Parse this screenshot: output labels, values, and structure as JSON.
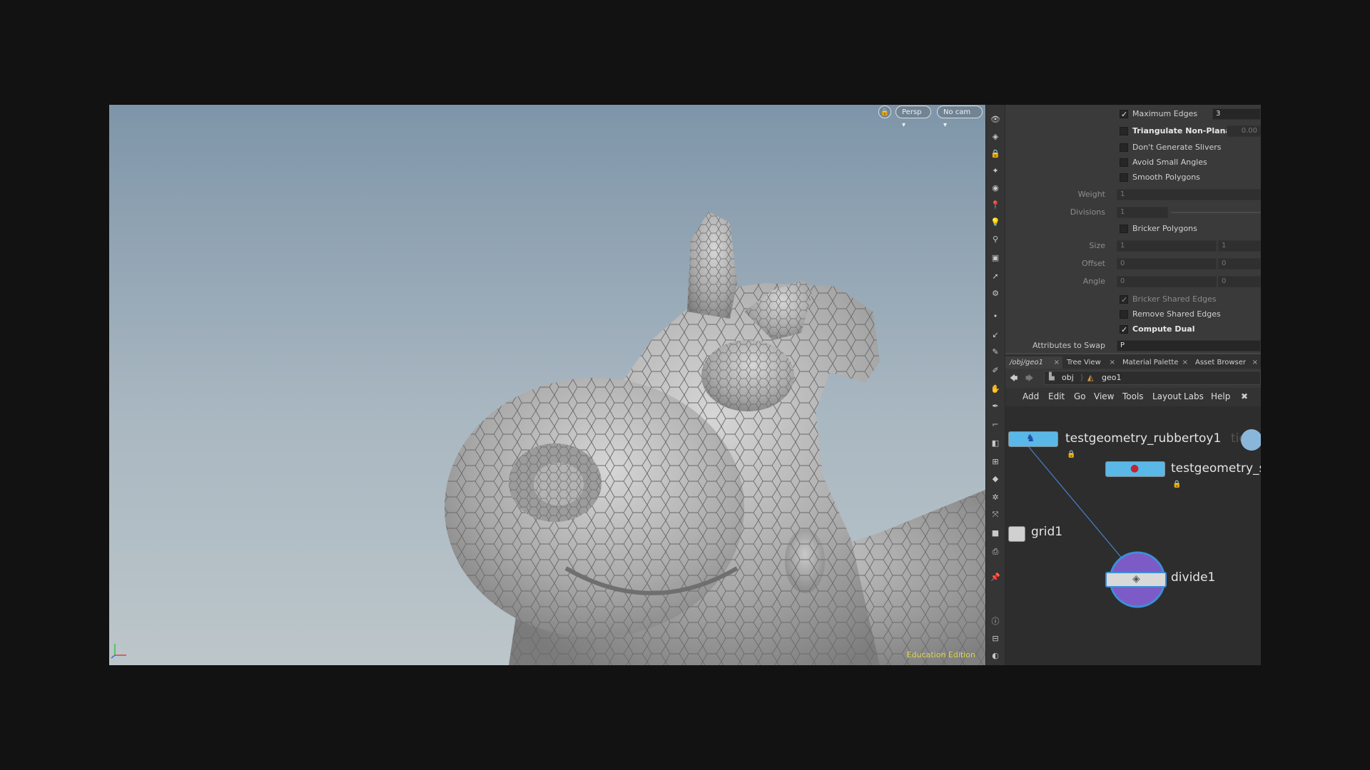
{
  "viewport": {
    "view_menu": "Persp ▾",
    "camera_menu": "No cam ▾",
    "edition": "Education Edition",
    "colors": {
      "sky_top": "#7e95a9",
      "sky_bottom": "#bcc6ca",
      "edition_text": "#e2d84a"
    }
  },
  "params": {
    "maximum_edges": {
      "label": "Maximum Edges",
      "checked": true,
      "value": "3"
    },
    "triangulate_non_planar": {
      "label": "Triangulate Non-Planar",
      "checked": false,
      "value": "0.00"
    },
    "dont_generate_slivers": {
      "label": "Don't Generate Slivers",
      "checked": false
    },
    "avoid_small_angles": {
      "label": "Avoid Small Angles",
      "checked": false
    },
    "smooth_polygons": {
      "label": "Smooth Polygons",
      "checked": false
    },
    "weight": {
      "label": "Weight",
      "value": "1"
    },
    "divisions": {
      "label": "Divisions",
      "value": "1"
    },
    "bricker_polygons": {
      "label": "Bricker Polygons",
      "checked": false
    },
    "size": {
      "label": "Size",
      "values": [
        "1",
        "1"
      ]
    },
    "offset": {
      "label": "Offset",
      "values": [
        "0",
        "0"
      ]
    },
    "angle": {
      "label": "Angle",
      "values": [
        "0",
        "0"
      ]
    },
    "bricker_shared_edges": {
      "label": "Bricker Shared Edges",
      "checked": true
    },
    "remove_shared_edges": {
      "label": "Remove Shared Edges",
      "checked": false
    },
    "compute_dual": {
      "label": "Compute Dual",
      "checked": true
    },
    "attributes_to_swap": {
      "label": "Attributes to Swap",
      "value": "P"
    }
  },
  "tabs": [
    {
      "label": "/obj/geo1"
    },
    {
      "label": "Tree View"
    },
    {
      "label": "Material Palette"
    },
    {
      "label": "Asset Browser"
    }
  ],
  "path": {
    "obj": "obj",
    "geo": "geo1"
  },
  "menu": [
    "Add",
    "Edit",
    "Go",
    "View",
    "Tools",
    "Layout",
    "Labs",
    "Help"
  ],
  "network": {
    "nodes": {
      "rubbertoy": "testgeometry_rubbertoy1",
      "testgeo2": "testgeometry_s",
      "grid": "grid1",
      "divide": "divide1",
      "ghost": "tion"
    },
    "colors": {
      "node_blue": "#59b8e8",
      "divide_ring": "#7d5bc6",
      "wire": "#4a7fc9"
    }
  }
}
